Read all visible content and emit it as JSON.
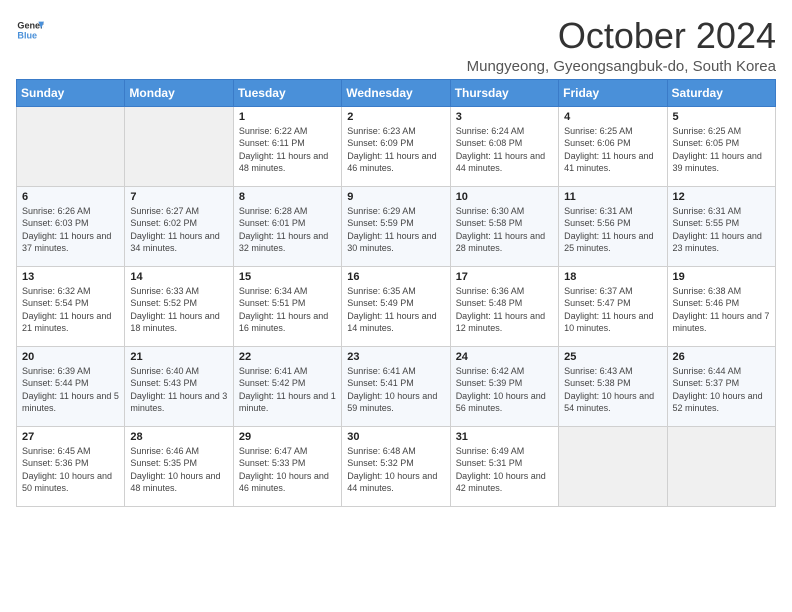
{
  "logo": {
    "general": "General",
    "blue": "Blue"
  },
  "title": "October 2024",
  "subtitle": "Mungyeong, Gyeongsangbuk-do, South Korea",
  "days_header": [
    "Sunday",
    "Monday",
    "Tuesday",
    "Wednesday",
    "Thursday",
    "Friday",
    "Saturday"
  ],
  "weeks": [
    [
      {
        "day": "",
        "info": ""
      },
      {
        "day": "",
        "info": ""
      },
      {
        "day": "1",
        "info": "Sunrise: 6:22 AM\nSunset: 6:11 PM\nDaylight: 11 hours and 48 minutes."
      },
      {
        "day": "2",
        "info": "Sunrise: 6:23 AM\nSunset: 6:09 PM\nDaylight: 11 hours and 46 minutes."
      },
      {
        "day": "3",
        "info": "Sunrise: 6:24 AM\nSunset: 6:08 PM\nDaylight: 11 hours and 44 minutes."
      },
      {
        "day": "4",
        "info": "Sunrise: 6:25 AM\nSunset: 6:06 PM\nDaylight: 11 hours and 41 minutes."
      },
      {
        "day": "5",
        "info": "Sunrise: 6:25 AM\nSunset: 6:05 PM\nDaylight: 11 hours and 39 minutes."
      }
    ],
    [
      {
        "day": "6",
        "info": "Sunrise: 6:26 AM\nSunset: 6:03 PM\nDaylight: 11 hours and 37 minutes."
      },
      {
        "day": "7",
        "info": "Sunrise: 6:27 AM\nSunset: 6:02 PM\nDaylight: 11 hours and 34 minutes."
      },
      {
        "day": "8",
        "info": "Sunrise: 6:28 AM\nSunset: 6:01 PM\nDaylight: 11 hours and 32 minutes."
      },
      {
        "day": "9",
        "info": "Sunrise: 6:29 AM\nSunset: 5:59 PM\nDaylight: 11 hours and 30 minutes."
      },
      {
        "day": "10",
        "info": "Sunrise: 6:30 AM\nSunset: 5:58 PM\nDaylight: 11 hours and 28 minutes."
      },
      {
        "day": "11",
        "info": "Sunrise: 6:31 AM\nSunset: 5:56 PM\nDaylight: 11 hours and 25 minutes."
      },
      {
        "day": "12",
        "info": "Sunrise: 6:31 AM\nSunset: 5:55 PM\nDaylight: 11 hours and 23 minutes."
      }
    ],
    [
      {
        "day": "13",
        "info": "Sunrise: 6:32 AM\nSunset: 5:54 PM\nDaylight: 11 hours and 21 minutes."
      },
      {
        "day": "14",
        "info": "Sunrise: 6:33 AM\nSunset: 5:52 PM\nDaylight: 11 hours and 18 minutes."
      },
      {
        "day": "15",
        "info": "Sunrise: 6:34 AM\nSunset: 5:51 PM\nDaylight: 11 hours and 16 minutes."
      },
      {
        "day": "16",
        "info": "Sunrise: 6:35 AM\nSunset: 5:49 PM\nDaylight: 11 hours and 14 minutes."
      },
      {
        "day": "17",
        "info": "Sunrise: 6:36 AM\nSunset: 5:48 PM\nDaylight: 11 hours and 12 minutes."
      },
      {
        "day": "18",
        "info": "Sunrise: 6:37 AM\nSunset: 5:47 PM\nDaylight: 11 hours and 10 minutes."
      },
      {
        "day": "19",
        "info": "Sunrise: 6:38 AM\nSunset: 5:46 PM\nDaylight: 11 hours and 7 minutes."
      }
    ],
    [
      {
        "day": "20",
        "info": "Sunrise: 6:39 AM\nSunset: 5:44 PM\nDaylight: 11 hours and 5 minutes."
      },
      {
        "day": "21",
        "info": "Sunrise: 6:40 AM\nSunset: 5:43 PM\nDaylight: 11 hours and 3 minutes."
      },
      {
        "day": "22",
        "info": "Sunrise: 6:41 AM\nSunset: 5:42 PM\nDaylight: 11 hours and 1 minute."
      },
      {
        "day": "23",
        "info": "Sunrise: 6:41 AM\nSunset: 5:41 PM\nDaylight: 10 hours and 59 minutes."
      },
      {
        "day": "24",
        "info": "Sunrise: 6:42 AM\nSunset: 5:39 PM\nDaylight: 10 hours and 56 minutes."
      },
      {
        "day": "25",
        "info": "Sunrise: 6:43 AM\nSunset: 5:38 PM\nDaylight: 10 hours and 54 minutes."
      },
      {
        "day": "26",
        "info": "Sunrise: 6:44 AM\nSunset: 5:37 PM\nDaylight: 10 hours and 52 minutes."
      }
    ],
    [
      {
        "day": "27",
        "info": "Sunrise: 6:45 AM\nSunset: 5:36 PM\nDaylight: 10 hours and 50 minutes."
      },
      {
        "day": "28",
        "info": "Sunrise: 6:46 AM\nSunset: 5:35 PM\nDaylight: 10 hours and 48 minutes."
      },
      {
        "day": "29",
        "info": "Sunrise: 6:47 AM\nSunset: 5:33 PM\nDaylight: 10 hours and 46 minutes."
      },
      {
        "day": "30",
        "info": "Sunrise: 6:48 AM\nSunset: 5:32 PM\nDaylight: 10 hours and 44 minutes."
      },
      {
        "day": "31",
        "info": "Sunrise: 6:49 AM\nSunset: 5:31 PM\nDaylight: 10 hours and 42 minutes."
      },
      {
        "day": "",
        "info": ""
      },
      {
        "day": "",
        "info": ""
      }
    ]
  ]
}
